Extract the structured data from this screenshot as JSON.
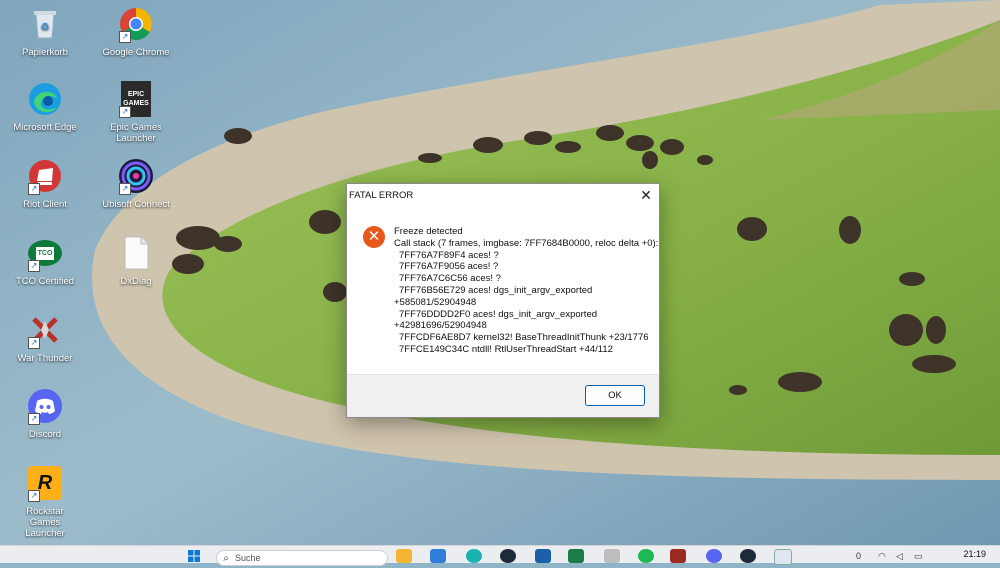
{
  "desktop": {
    "icons": [
      {
        "label": "Papierkorb",
        "icon": "recycle-bin-icon"
      },
      {
        "label": "Google Chrome",
        "icon": "chrome-icon"
      },
      {
        "label": "Microsoft Edge",
        "icon": "edge-icon"
      },
      {
        "label": "Epic Games Launcher",
        "icon": "epic-games-icon",
        "badge": "EPIC GAMES"
      },
      {
        "label": "Riot Client",
        "icon": "riot-client-icon"
      },
      {
        "label": "Ubisoft Connect",
        "icon": "ubisoft-icon"
      },
      {
        "label": "TCO Certified",
        "icon": "tco-certified-icon",
        "badge": "TCO"
      },
      {
        "label": "DxDiag",
        "icon": "dxdiag-icon"
      },
      {
        "label": "War Thunder",
        "icon": "war-thunder-icon"
      },
      {
        "label": "Discord",
        "icon": "discord-icon"
      },
      {
        "label": "Rockstar Games Launcher",
        "icon": "rockstar-icon",
        "badge": "R"
      }
    ]
  },
  "dialog": {
    "title": "FATAL ERROR",
    "lines": [
      "Freeze detected",
      "Call stack (7 frames, imgbase: 7FF7684B0000, reloc delta +0):",
      "  7FF76A7F89F4 aces! ?",
      "  7FF76A7F9056 aces! ?",
      "  7FF76A7C6C56 aces! ?",
      "  7FF76B56E729 aces! dgs_init_argv_exported",
      "+585081/52904948",
      "  7FF76DDDD2F0 aces! dgs_init_argv_exported",
      "+42981696/52904948",
      "  7FFCDF6AE8D7 kernel32! BaseThreadInitThunk  +23/1776",
      "  7FFCE149C34C ntdll! RtlUserThreadStart  +44/112"
    ],
    "ok_label": "OK",
    "close_glyph": "✕"
  },
  "taskbar": {
    "search_placeholder": "Suche",
    "clock": "21:19",
    "tray_text": "0"
  },
  "colors": {
    "error_icon": "#e8581c",
    "ok_border": "#0063b1",
    "taskbar": "#ecedf0"
  }
}
